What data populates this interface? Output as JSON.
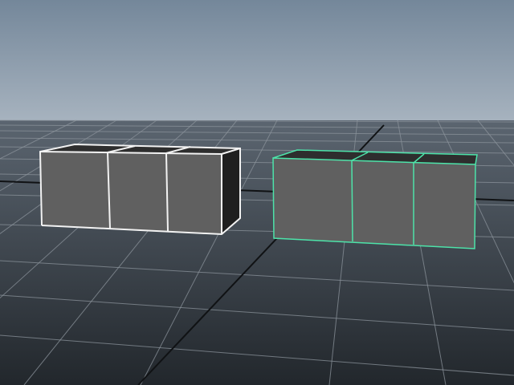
{
  "viewport": {
    "view": "perspective",
    "colors": {
      "sky_top": "#74879a",
      "sky_horizon": "#a7b3bf",
      "ground_near": "#22272c",
      "ground_far": "#5b6570",
      "grid_line": "#8b939b",
      "axis_line": "#101214",
      "cube_face_front": "#606060",
      "cube_face_top": "#2e2e2e",
      "cube_face_side": "#1f1f1f",
      "wire_unselected": "#f2f2f2",
      "wire_selected": "#4de3a9"
    },
    "objects": [
      {
        "name": "cube-group-left",
        "state": "unselected",
        "segments": 3
      },
      {
        "name": "cube-group-right",
        "state": "selected",
        "segments": 3
      }
    ]
  }
}
